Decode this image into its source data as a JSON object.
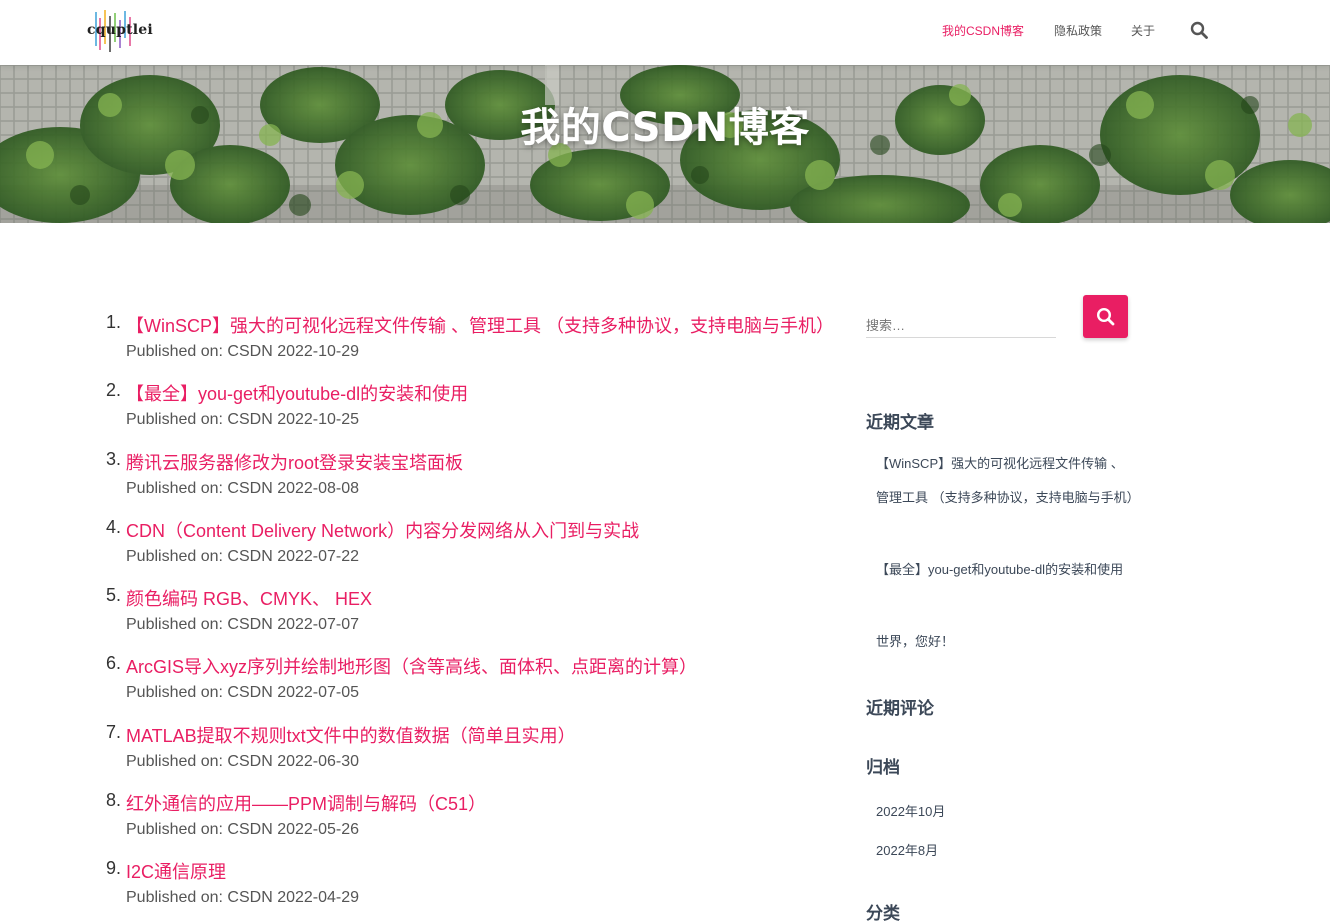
{
  "brand": {
    "logo_text": "cquptlei"
  },
  "nav": {
    "items": [
      {
        "label": "我的CSDN博客",
        "active": true
      },
      {
        "label": "隐私政策",
        "active": false
      },
      {
        "label": "关于",
        "active": false
      }
    ],
    "search_icon": "search-icon"
  },
  "hero": {
    "title": "我的CSDN博客"
  },
  "posts": [
    {
      "num": "1.",
      "title": "【WinSCP】强大的可视化远程文件传输 、管理工具 （支持多种协议，支持电脑与手机）",
      "meta": "Published on: CSDN 2022-10-29"
    },
    {
      "num": "2.",
      "title": "【最全】you-get和youtube-dl的安装和使用",
      "meta": "Published on: CSDN 2022-10-25"
    },
    {
      "num": "3.",
      "title": "腾讯云服务器修改为root登录安装宝塔面板",
      "meta": "Published on: CSDN 2022-08-08"
    },
    {
      "num": "4.",
      "title": "CDN（Content Delivery Network）内容分发网络从入门到与实战",
      "meta": "Published on: CSDN 2022-07-22"
    },
    {
      "num": "5.",
      "title": "颜色编码 RGB、CMYK、 HEX",
      "meta": "Published on: CSDN 2022-07-07"
    },
    {
      "num": "6.",
      "title": "ArcGIS导入xyz序列并绘制地形图（含等高线、面体积、点距离的计算）",
      "meta": "Published on: CSDN 2022-07-05"
    },
    {
      "num": "7.",
      "title": "MATLAB提取不规则txt文件中的数值数据（简单且实用）",
      "meta": "Published on: CSDN 2022-06-30"
    },
    {
      "num": "8.",
      "title": "红外通信的应用——PPM调制与解码（C51）",
      "meta": "Published on: CSDN 2022-05-26"
    },
    {
      "num": "9.",
      "title": "I2C通信原理",
      "meta": "Published on: CSDN 2022-04-29"
    }
  ],
  "sidebar": {
    "search": {
      "placeholder": "搜索…",
      "button_icon": "search-icon"
    },
    "recent_posts": {
      "title": "近期文章",
      "items": [
        "【WinSCP】强大的可视化远程文件传输 、管理工具 （支持多种协议，支持电脑与手机）",
        "【最全】you-get和youtube-dl的安装和使用",
        "世界，您好！"
      ]
    },
    "recent_comments": {
      "title": "近期评论"
    },
    "archives": {
      "title": "归档",
      "items": [
        "2022年10月",
        "2022年8月"
      ]
    },
    "categories": {
      "title": "分类"
    }
  },
  "colors": {
    "accent": "#e91e63",
    "text": "#404040",
    "heading": "#3c4858"
  }
}
